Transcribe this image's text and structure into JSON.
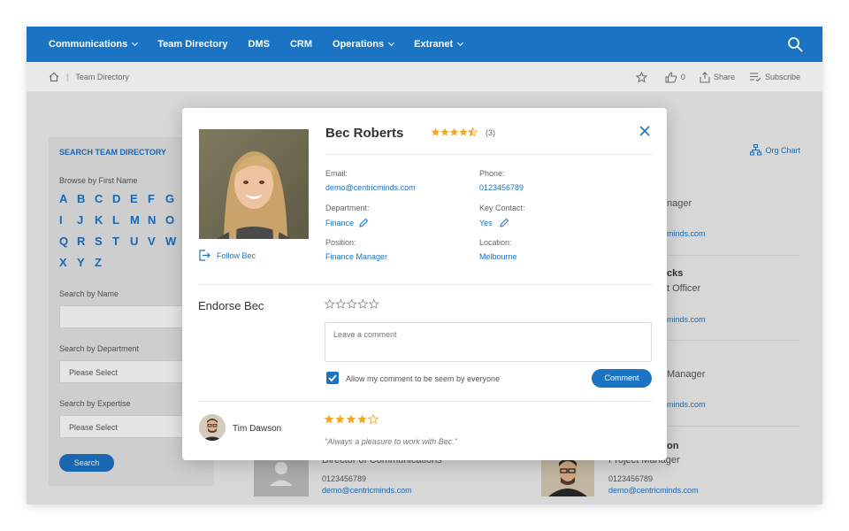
{
  "nav": {
    "items": [
      {
        "label": "Communications",
        "has_dropdown": true
      },
      {
        "label": "Team Directory",
        "has_dropdown": false
      },
      {
        "label": "DMS",
        "has_dropdown": false
      },
      {
        "label": "CRM",
        "has_dropdown": false
      },
      {
        "label": "Operations",
        "has_dropdown": true
      },
      {
        "label": "Extranet",
        "has_dropdown": true
      }
    ],
    "search_icon": "search-icon"
  },
  "breadcrumb": {
    "current": "Team Directory"
  },
  "actions": {
    "like_count": "0",
    "share": "Share",
    "subscribe": "Subscribe"
  },
  "sidebar": {
    "title": "SEARCH TEAM DIRECTORY",
    "browse_label": "Browse by First Name",
    "letters": [
      "A",
      "B",
      "C",
      "D",
      "E",
      "F",
      "G",
      "I",
      "J",
      "K",
      "L",
      "M",
      "N",
      "O",
      "Q",
      "R",
      "S",
      "T",
      "U",
      "V",
      "W",
      "X",
      "Y",
      "Z"
    ],
    "search_name_label": "Search by Name",
    "department_label": "Search by Department",
    "department_value": "Please Select",
    "expertise_label": "Search by Expertise",
    "expertise_value": "Please Select",
    "search_button": "Search"
  },
  "org_chart": "Org Chart",
  "background": {
    "role1": "nager",
    "link1": "minds.com",
    "name2": "cks",
    "role2": "t Officer",
    "link2": "minds.com",
    "role3": "Manager",
    "link3": "minds.com",
    "name4": "on",
    "role4": "Project Manager",
    "role5": "Director of Communications",
    "phone5": "0123456789",
    "email5": "demo@centricminds.com",
    "phone6": "0123456789",
    "email6": "demo@centricminds.com"
  },
  "profile": {
    "name": "Bec Roberts",
    "rating": 4.5,
    "rating_count": "(3)",
    "follow": "Follow Bec",
    "email_label": "Email:",
    "email": "demo@centricminds.com",
    "phone_label": "Phone:",
    "phone": "0123456789",
    "department_label": "Department:",
    "department": "Finance",
    "key_contact_label": "Key Contact:",
    "key_contact": "Yes",
    "position_label": "Position:",
    "position": "Finance Manager",
    "location_label": "Location:",
    "location": "Melbourne"
  },
  "endorse": {
    "title": "Endorse Bec",
    "placeholder": "Leave a comment",
    "allow_label": "Allow my comment to be seem by everyone",
    "allow_checked": true,
    "button": "Comment"
  },
  "review": {
    "reviewer": "Tim Dawson",
    "rating": 4,
    "text": "\"Always a pleasure to work with Bec.\""
  },
  "colors": {
    "accent": "#1b73c4",
    "star": "#f5a623"
  }
}
